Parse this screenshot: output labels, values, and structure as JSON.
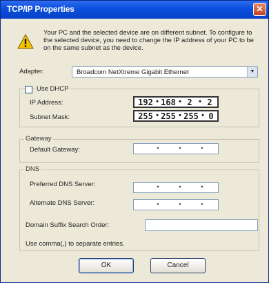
{
  "window": {
    "title": "TCP/IP Properties",
    "close_glyph": "✕"
  },
  "icons": {
    "warning": "warning-icon",
    "close": "close-icon",
    "dropdown": "chevron-down-icon"
  },
  "message": "Your PC and the selected device are on different subnet. To configure to the selected device, you need to change the IP address of your PC to be on the same subnet as the device.",
  "adapter": {
    "label": "Adapter:",
    "value": "Broadcom NetXtreme Gigabit Ethernet"
  },
  "dhcp": {
    "label": "Use DHCP",
    "checked": false
  },
  "ip_address": {
    "label": "IP Address:",
    "octets": [
      "192",
      "168",
      "2",
      "2"
    ]
  },
  "subnet_mask": {
    "label": "Subnet Mask:",
    "octets": [
      "255",
      "255",
      "255",
      "0"
    ]
  },
  "gateway": {
    "group_label": "Gateway",
    "label": "Default Gateway:",
    "octets": [
      "",
      "",
      "",
      ""
    ]
  },
  "dns": {
    "group_label": "DNS",
    "preferred_label": "Preferred DNS Server:",
    "preferred_octets": [
      "",
      "",
      "",
      ""
    ],
    "alternate_label": "Alternate DNS Server:",
    "alternate_octets": [
      "",
      "",
      "",
      ""
    ],
    "suffix_label": "Domain Suffix Search Order:",
    "suffix_value": "",
    "hint": "Use comma(,) to separate entries."
  },
  "buttons": {
    "ok": "OK",
    "cancel": "Cancel"
  },
  "colors": {
    "titlebar": "#0a4fdc",
    "dialog_bg": "#ece9d8",
    "close_button": "#c24020",
    "warning": "#f5c400"
  }
}
